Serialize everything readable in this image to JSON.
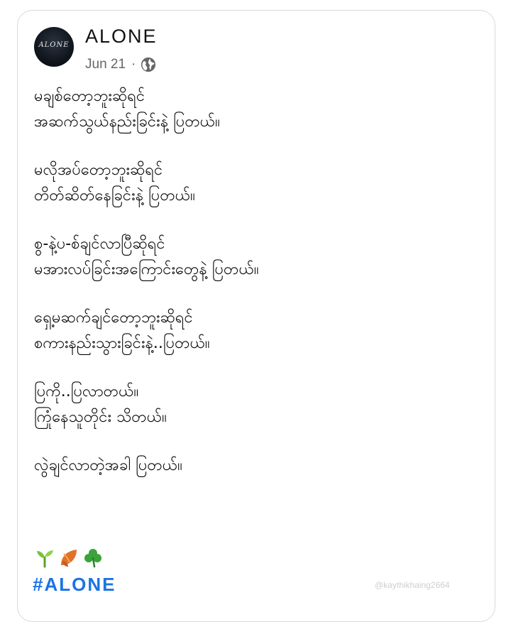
{
  "post": {
    "author": "ALONE",
    "avatar_text": "ALONE",
    "date": "Jun 21",
    "separator": "·",
    "privacy_icon": "globe-icon",
    "stanzas": [
      {
        "lines": [
          "မချစ်တော့ဘူးဆိုရင်",
          "အဆက်သွယ်နည်းခြင်းနဲ့ ပြတယ်။"
        ]
      },
      {
        "lines": [
          "မလိုအပ်တော့ဘူးဆိုရင်",
          "တိတ်ဆိတ်နေခြင်းနဲ့ ပြတယ်။"
        ]
      },
      {
        "lines": [
          "စွ-နဲ့ပ-စ်ချင်လာပြီဆိုရင်",
          "မအားလပ်ခြင်းအကြောင်းတွေနဲ့ ပြတယ်။"
        ]
      },
      {
        "lines": [
          "ရှေ့မဆက်ချင်တော့ဘူးဆိုရင်",
          "စကားနည်းသွားခြင်းနဲ့..ပြတယ်။"
        ]
      },
      {
        "lines": [
          "ပြကို..ပြလာတယ်။",
          "ကြုံနေသူတိုင်း သိတယ်။"
        ]
      },
      {
        "lines": [
          "လွဲချင်လာတဲ့အခါ ပြတယ်။"
        ]
      }
    ],
    "emojis": [
      "seedling-emoji",
      "fallen-leaf-emoji",
      "shamrock-emoji"
    ],
    "hashtag": "#ALONE"
  },
  "watermark": "@kaythikhaing2664"
}
